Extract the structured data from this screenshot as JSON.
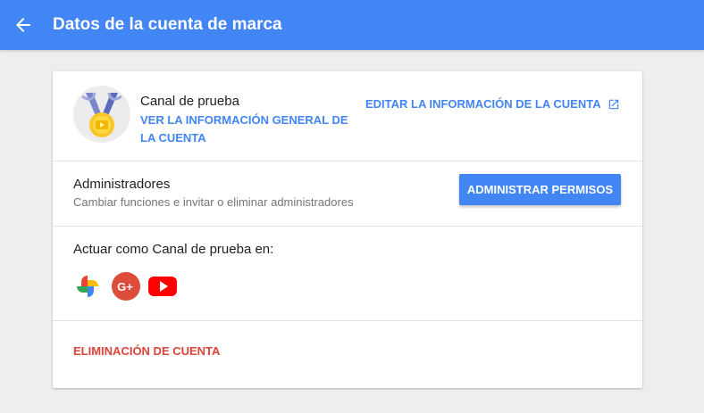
{
  "header": {
    "title": "Datos de la cuenta de marca",
    "back_icon": "arrow-back-icon",
    "bg_color": "#4285f4"
  },
  "account": {
    "channel_name": "Canal de prueba",
    "overview_link": "VER LA INFORMACIÓN GENERAL DE LA CUENTA",
    "edit_link": "EDITAR LA INFORMACIÓN DE LA CUENTA",
    "edit_link_icon": "open-in-new-icon",
    "avatar_icon": "medal-avatar-icon"
  },
  "admins": {
    "title": "Administradores",
    "subtitle": "Cambiar funciones e invitar o eliminar administradores",
    "button_label": "ADMINISTRAR PERMISOS"
  },
  "act_as": {
    "label": "Actuar como Canal de prueba en:",
    "services": [
      {
        "icon": "google-photos-icon"
      },
      {
        "icon": "google-plus-icon",
        "text": "G+"
      },
      {
        "icon": "youtube-icon"
      }
    ]
  },
  "delete": {
    "label": "ELIMINACIÓN DE CUENTA",
    "color": "#db4437"
  },
  "colors": {
    "accent": "#4285f4",
    "danger": "#db4437",
    "background": "#eeeeee"
  }
}
